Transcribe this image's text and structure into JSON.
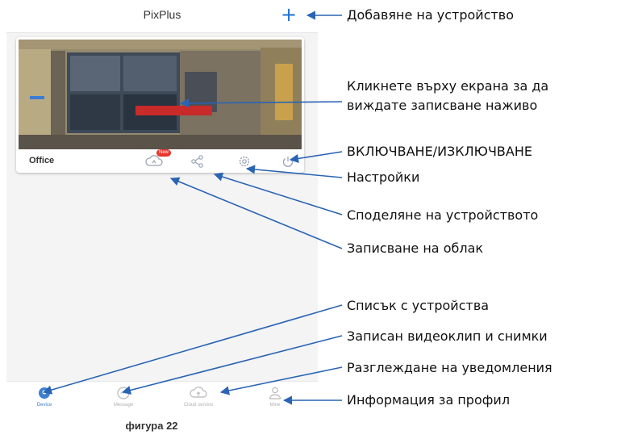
{
  "app": {
    "title": "PixPlus",
    "add_icon": "plus-icon"
  },
  "device_card": {
    "name": "Office",
    "cloud_badge": "New",
    "actions": [
      "cloud-recording-icon",
      "share-icon",
      "settings-icon",
      "power-icon"
    ]
  },
  "tabs": [
    {
      "label": "Device",
      "icon": "device-icon",
      "active": true
    },
    {
      "label": "Message",
      "icon": "message-icon",
      "active": false
    },
    {
      "label": "Cloud service",
      "icon": "cloud-icon",
      "active": false
    },
    {
      "label": "Mine",
      "icon": "profile-icon",
      "active": false
    }
  ],
  "annotations": {
    "add_device": "Добавяне на устройство",
    "live_view_1": "Кликнете върху екрана за да",
    "live_view_2": "виждате записване наживо",
    "power": "ВКЛЮЧВАНЕ/ИЗКЛЮЧВАНЕ",
    "settings": "Настройки",
    "share": "Споделяне на устройството",
    "cloud": "Записване на облак",
    "device_list": "Списък с устройства",
    "recorded": "Записан видеоклип и снимки",
    "notifications": "Разглеждане на уведомления",
    "profile": "Информация за профил"
  },
  "caption": "фигура 22",
  "colors": {
    "accent": "#1d6fd6",
    "arrow": "#2a64b4",
    "badge": "#e8362e"
  }
}
